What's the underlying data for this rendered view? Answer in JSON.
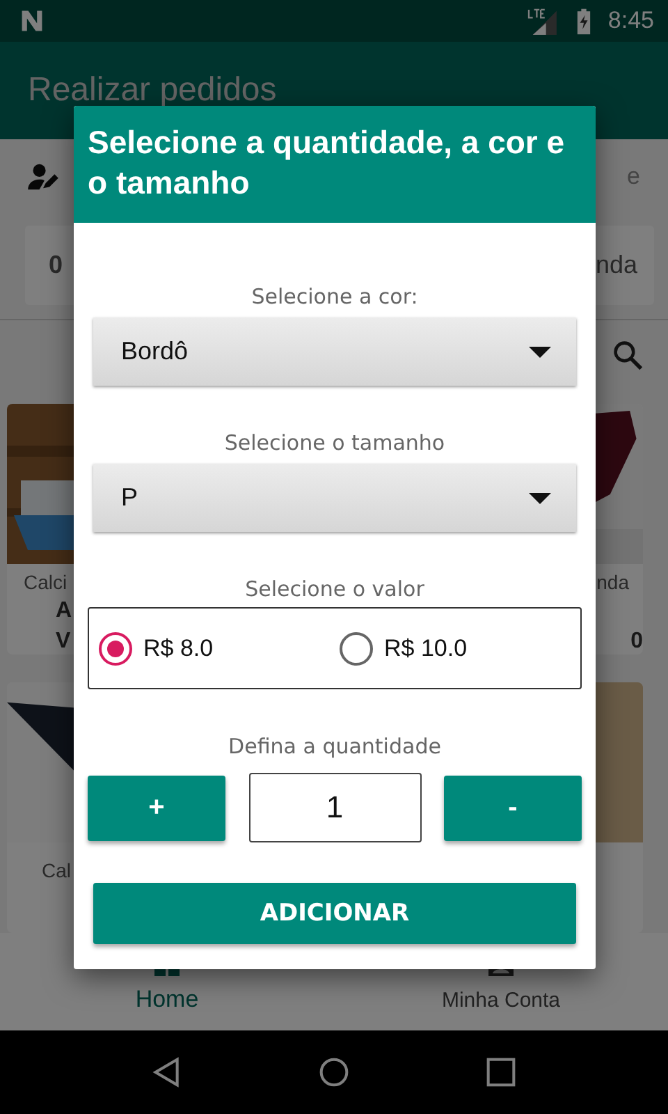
{
  "status_bar": {
    "time": "8:45"
  },
  "app_bar": {
    "title": "Realizar pedidos"
  },
  "background": {
    "user_text": "e",
    "summary": [
      {
        "text": "0"
      },
      {
        "text": "nda"
      }
    ],
    "cards": [
      {
        "kind": "picture",
        "lines": [
          {
            "text": "Calci",
            "kind": "name"
          },
          {
            "text": "A",
            "kind": "detail"
          },
          {
            "text": "V",
            "kind": "detail"
          }
        ]
      },
      {
        "kind": "picture",
        "lines": [
          {
            "text": "nda",
            "kind": "name"
          },
          {
            "text": "0",
            "kind": "detail"
          }
        ]
      },
      {
        "kind": "picture",
        "lines": [
          {
            "text": "Cal",
            "kind": "name"
          }
        ]
      },
      {
        "kind": "picture"
      }
    ]
  },
  "dialog": {
    "title": "Selecione a quantidade, a cor e o tamanho",
    "color_label": "Selecione a cor:",
    "color_value": "Bordô",
    "size_label": "Selecione o tamanho",
    "size_value": "P",
    "price_label": "Selecione o valor",
    "prices": [
      {
        "label": "R$ 8.0",
        "selected": true
      },
      {
        "label": "R$ 10.0",
        "selected": false
      }
    ],
    "quantity_label": "Defina a quantidade",
    "increment": "+",
    "quantity": "1",
    "decrement": "-",
    "submit": "ADICIONAR"
  },
  "bottom_nav": [
    {
      "label": "Home",
      "selected": true
    },
    {
      "label": "Minha Conta",
      "selected": false
    }
  ]
}
